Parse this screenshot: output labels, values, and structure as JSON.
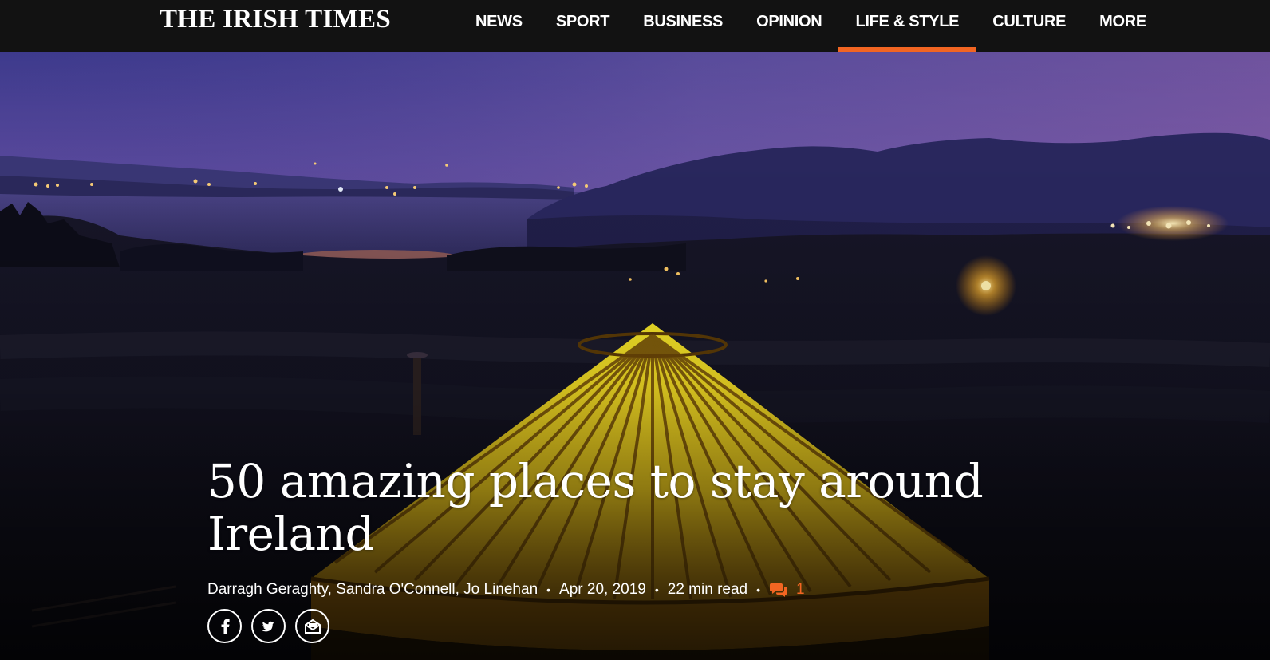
{
  "masthead": {
    "title": "THE IRISH TIMES"
  },
  "nav": {
    "items": [
      "NEWS",
      "SPORT",
      "BUSINESS",
      "OPINION",
      "LIFE & STYLE",
      "CULTURE",
      "MORE"
    ],
    "active": "LIFE & STYLE",
    "accent_color": "#f26522"
  },
  "article": {
    "headline": "50 amazing places to stay around Ireland",
    "authors": "Darragh Geraghty, Sandra O'Connell, Jo Linehan",
    "date": "Apr 20, 2019",
    "read_time": "22 min read",
    "comment_count": "1",
    "separator": "•"
  },
  "share": {
    "buttons": [
      "facebook-icon",
      "twitter-icon",
      "email-icon"
    ]
  }
}
